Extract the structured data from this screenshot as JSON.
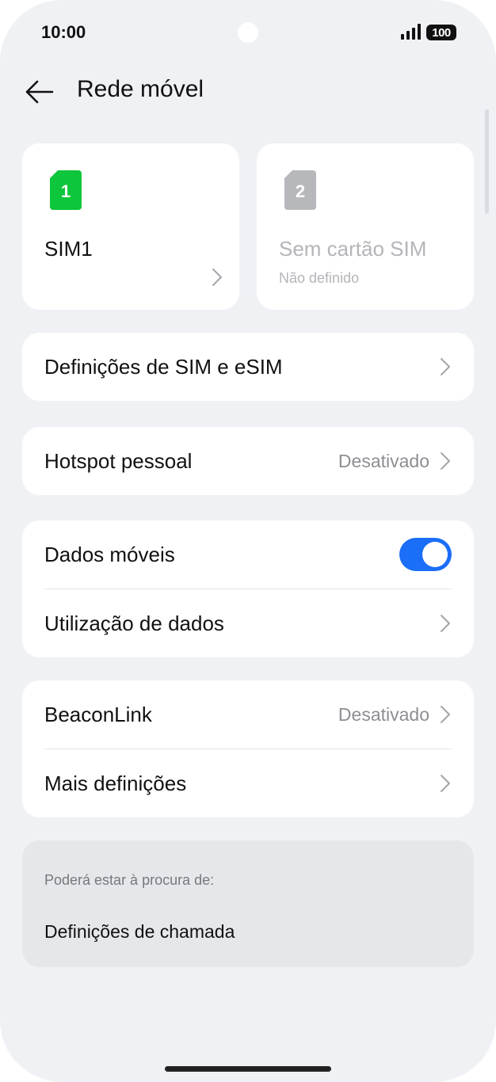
{
  "status_bar": {
    "time": "10:00",
    "battery": "100",
    "signal_icon": "signal-bars-icon"
  },
  "header": {
    "title": "Rede móvel",
    "back_icon": "arrow-left-icon"
  },
  "sims": [
    {
      "number": "1",
      "name": "SIM1",
      "subtitle": "",
      "color": "#0ec63b",
      "active": true
    },
    {
      "number": "2",
      "name": "Sem cartão SIM",
      "subtitle": "Não definido",
      "color": "#b7b8bc",
      "active": false
    }
  ],
  "sim_settings": {
    "label": "Definições de SIM e eSIM"
  },
  "hotspot": {
    "label": "Hotspot pessoal",
    "value": "Desativado"
  },
  "mobile_data": {
    "label": "Dados móveis",
    "enabled": true
  },
  "data_usage": {
    "label": "Utilização de dados"
  },
  "beaconlink": {
    "label": "BeaconLink",
    "value": "Desativado"
  },
  "more_settings": {
    "label": "Mais definições"
  },
  "suggestions": {
    "heading": "Poderá estar à procura de:",
    "items": [
      "Definições de chamada"
    ]
  },
  "colors": {
    "accent": "#1a6ef7",
    "background": "#f0f1f5",
    "card": "#ffffff",
    "sim_active": "#0ec63b"
  }
}
